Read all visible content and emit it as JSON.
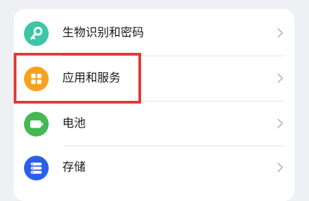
{
  "settings": {
    "items": [
      {
        "label": "生物识别和密码",
        "icon": "key-icon",
        "color": "#3dc6a6"
      },
      {
        "label": "应用和服务",
        "icon": "apps-grid-icon",
        "color": "#f7a21e"
      },
      {
        "label": "电池",
        "icon": "battery-icon",
        "color": "#43b853"
      },
      {
        "label": "存储",
        "icon": "storage-icon",
        "color": "#2a5fe8"
      }
    ]
  },
  "annotation": {
    "color": "#e3393a"
  }
}
